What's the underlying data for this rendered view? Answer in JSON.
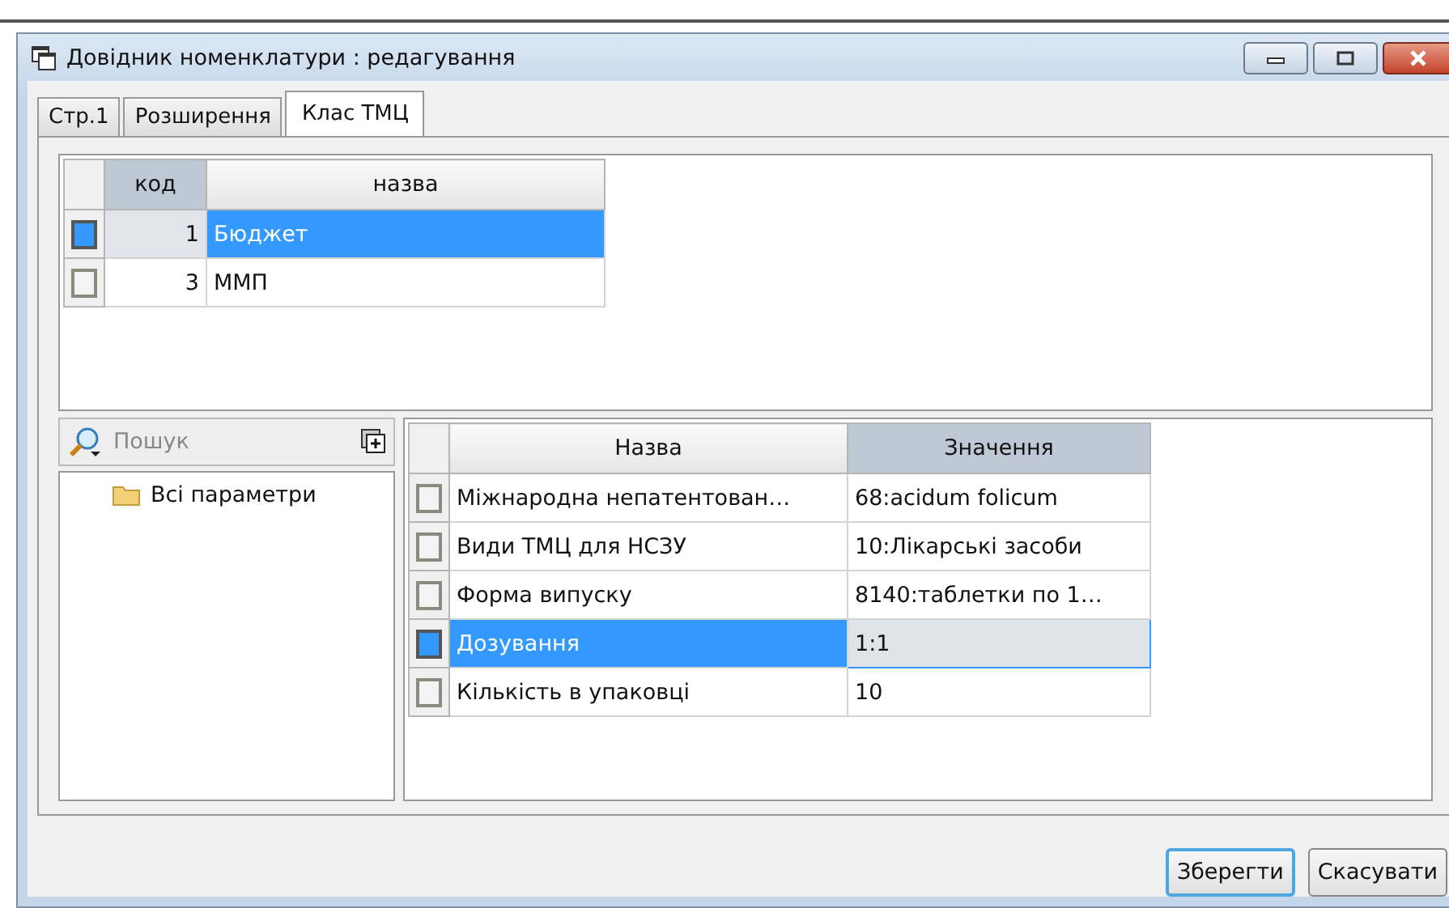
{
  "window": {
    "title": "Довідник номенклатури : редагування"
  },
  "tabs": [
    {
      "label": "Стр.1",
      "selected": false
    },
    {
      "label": "Розширення",
      "selected": false
    },
    {
      "label": "Клас ТМЦ",
      "selected": true
    }
  ],
  "class_table": {
    "columns": [
      {
        "label": "код",
        "selected": true
      },
      {
        "label": "назва",
        "selected": false
      }
    ],
    "rows": [
      {
        "code": "1",
        "name": "Бюджет",
        "selected": true
      },
      {
        "code": "3",
        "name": "ММП",
        "selected": false
      }
    ]
  },
  "search": {
    "placeholder": "Пошук"
  },
  "tree": [
    {
      "label": "Всі параметри"
    }
  ],
  "params_table": {
    "columns": [
      {
        "label": "Назва",
        "selected": false
      },
      {
        "label": "Значення",
        "selected": true
      }
    ],
    "rows": [
      {
        "name": "Міжнародна непатентован…",
        "value": "68:acidum folicum",
        "selected": false
      },
      {
        "name": "Види ТМЦ для НСЗУ",
        "value": "10:Лікарські засоби",
        "selected": false
      },
      {
        "name": "Форма випуску",
        "value": "8140:таблетки по 1…",
        "selected": false
      },
      {
        "name": "Дозування",
        "value": "1:1",
        "selected": true
      },
      {
        "name": "Кількість в упаковці",
        "value": "10",
        "selected": false
      }
    ]
  },
  "buttons": [
    {
      "label": "Зберегти",
      "default": true
    },
    {
      "label": "Скасувати",
      "default": false
    }
  ]
}
